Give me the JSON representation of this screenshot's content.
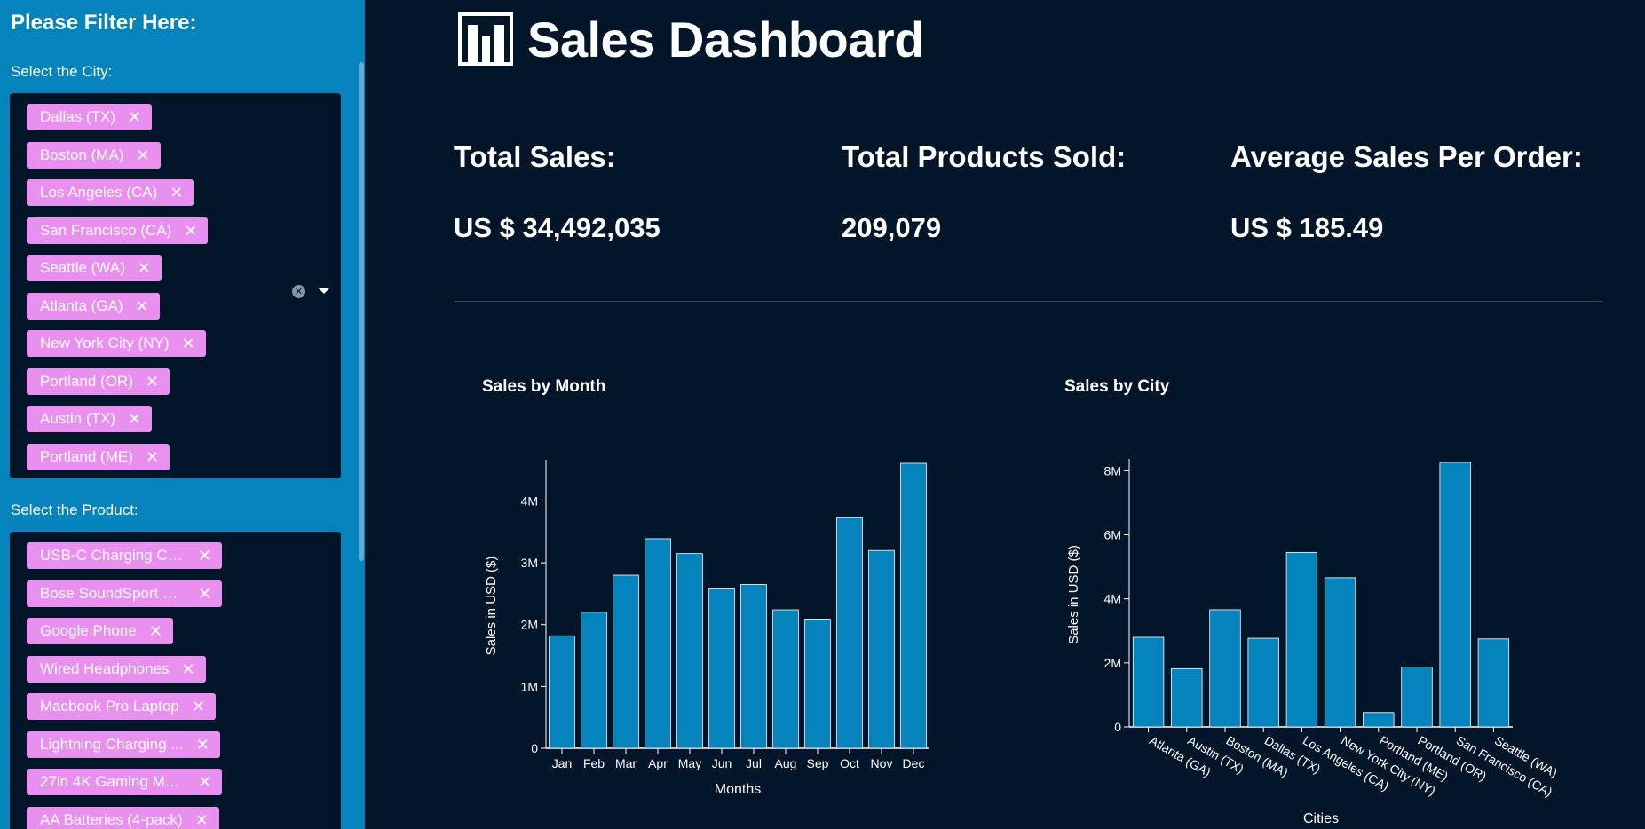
{
  "sidebar": {
    "title": "Please Filter Here:",
    "city_label": "Select the City:",
    "cities": [
      "Dallas (TX)",
      "Boston (MA)",
      "Los Angeles (CA)",
      "San Francisco (CA)",
      "Seattle (WA)",
      "Atlanta (GA)",
      "New York City (NY)",
      "Portland (OR)",
      "Austin (TX)",
      "Portland (ME)"
    ],
    "product_label": "Select the Product:",
    "products": [
      "USB-C Charging Ca...",
      "Bose SoundSport H...",
      "Google Phone",
      "Wired Headphones",
      "Macbook Pro Laptop",
      "Lightning Charging ...",
      "27in 4K Gaming Mo...",
      "AA Batteries (4-pack)"
    ],
    "remove_glyph": "✕",
    "clear_glyph": "✕"
  },
  "header": {
    "title": "Sales Dashboard",
    "logo_icon": "bar-chart-icon"
  },
  "kpis": [
    {
      "label": "Total Sales:",
      "value": "US $ 34,492,035"
    },
    {
      "label": "Total Products Sold:",
      "value": "209,079"
    },
    {
      "label": "Average Sales Per Order:",
      "value": "US $ 185.49"
    }
  ],
  "colors": {
    "background": "#021529",
    "sidebar": "#0583bd",
    "bar": "#0583bd",
    "tag": "#e88ff0"
  },
  "chart_data": [
    {
      "type": "bar",
      "title": "Sales by Month",
      "xlabel": "Months",
      "ylabel": "Sales in USD ($)",
      "categories": [
        "Jan",
        "Feb",
        "Mar",
        "Apr",
        "May",
        "Jun",
        "Jul",
        "Aug",
        "Sep",
        "Oct",
        "Nov",
        "Dec"
      ],
      "values": [
        1820000,
        2200000,
        2800000,
        3390000,
        3150000,
        2580000,
        2650000,
        2240000,
        2090000,
        3730000,
        3200000,
        4610000
      ],
      "yticks": [
        0,
        1000000,
        2000000,
        3000000,
        4000000
      ],
      "ytick_labels": [
        "0",
        "1M",
        "2M",
        "3M",
        "4M"
      ],
      "ylim": [
        0,
        4610000
      ],
      "grid": false,
      "tick_rotation": 0
    },
    {
      "type": "bar",
      "title": "Sales by City",
      "xlabel": "Cities",
      "ylabel": "Sales in USD ($)",
      "categories": [
        "Atlanta (GA)",
        "Austin (TX)",
        "Boston (MA)",
        "Dallas (TX)",
        "Los Angeles (CA)",
        "New York City (NY)",
        "Portland (ME)",
        "Portland (OR)",
        "San Francisco (CA)",
        "Seattle (WA)"
      ],
      "values": [
        2800000,
        1820000,
        3660000,
        2770000,
        5450000,
        4660000,
        450000,
        1870000,
        8260000,
        2750000
      ],
      "yticks": [
        0,
        2000000,
        4000000,
        6000000,
        8000000
      ],
      "ytick_labels": [
        "0",
        "2M",
        "4M",
        "6M",
        "8M"
      ],
      "ylim": [
        0,
        8260000
      ],
      "grid": false,
      "tick_rotation": 30
    }
  ]
}
